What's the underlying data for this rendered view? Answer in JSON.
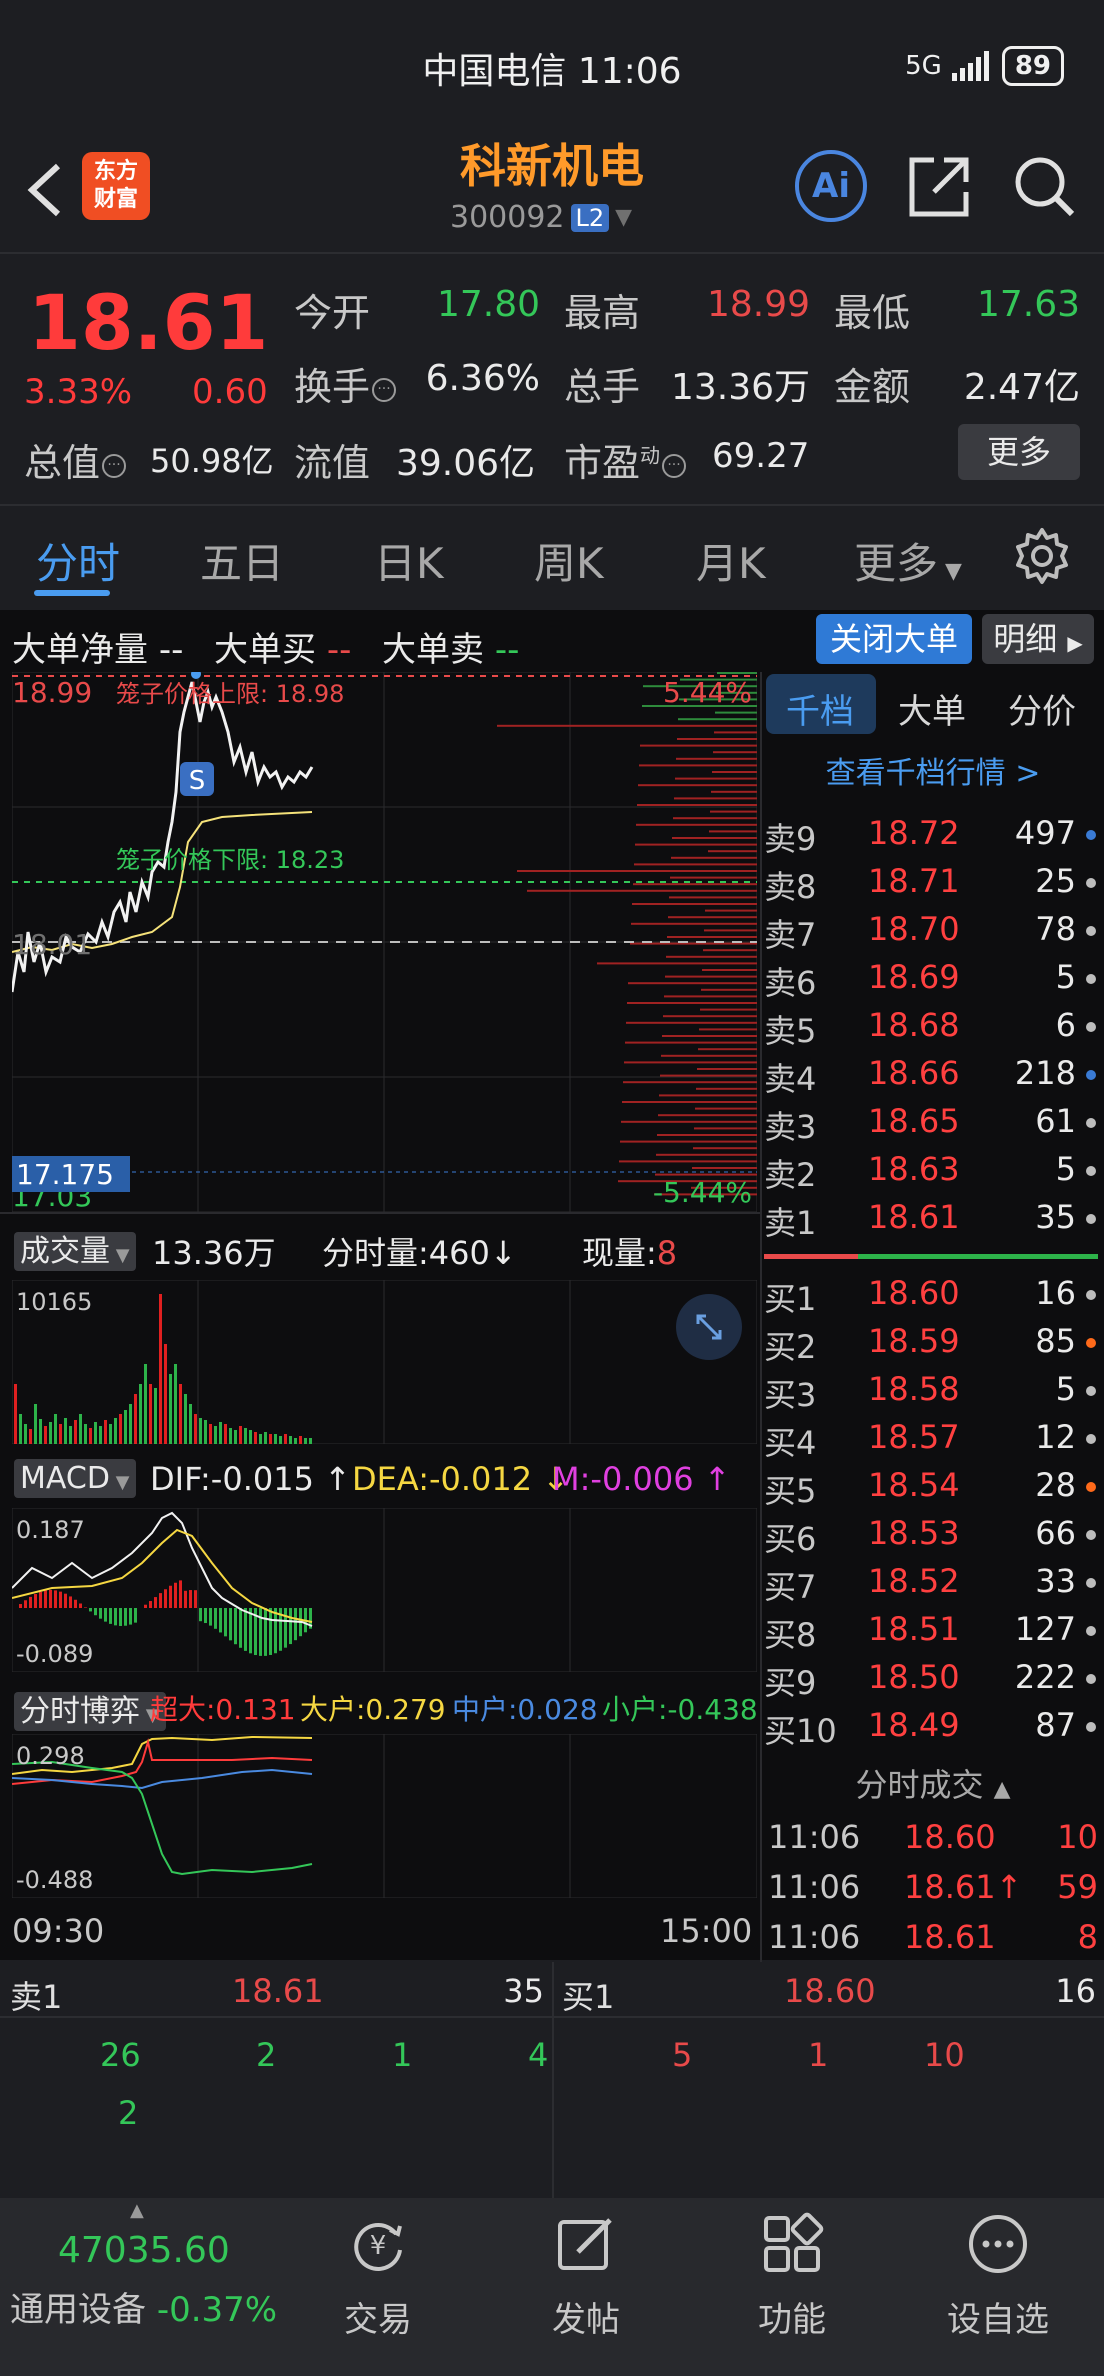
{
  "status_bar": {
    "carrier_time": "中国电信 11:06",
    "network": "5G",
    "battery": "89"
  },
  "header": {
    "stock_name": "科新机电",
    "stock_code": "300092",
    "level_badge": "L2",
    "logo_text_1": "东方",
    "logo_text_2": "财富",
    "ai_label": "Ai"
  },
  "quote": {
    "price": "18.61",
    "change_pct": "3.33%",
    "change_abs": "0.60",
    "fields": {
      "open_label": "今开",
      "open": "17.80",
      "high_label": "最高",
      "high": "18.99",
      "low_label": "最低",
      "low": "17.63",
      "turnover_label": "换手",
      "turnover": "6.36%",
      "volume_label": "总手",
      "volume": "13.36万",
      "amount_label": "金额",
      "amount": "2.47亿",
      "mktcap_label": "总值",
      "mktcap": "50.98亿",
      "float_label": "流值",
      "float": "39.06亿",
      "pe_label": "市盈",
      "pe_sup": "动",
      "pe": "69.27"
    },
    "more_label": "更多"
  },
  "tabs": [
    "分时",
    "五日",
    "日K",
    "周K",
    "月K",
    "更多"
  ],
  "big_order": {
    "net_label": "大单净量",
    "net_value": "--",
    "buy_label": "大单买",
    "buy_value": "--",
    "sell_label": "大单卖",
    "sell_value": "--",
    "close_btn": "关闭大单",
    "detail_btn": "明细"
  },
  "main_chart": {
    "top_price": "18.99",
    "upper_limit": "笼子价格上限: 18.98",
    "top_pct": "5.44%",
    "lower_limit": "笼子价格下限: 18.23",
    "mid_price": "18.01",
    "bottom_price": "17.175",
    "bottom_pct": "-5.44%",
    "bottom_price_under": "17.03",
    "marker": "S"
  },
  "order_book": {
    "tabs": [
      "千档",
      "大单",
      "分价"
    ],
    "link": "查看千档行情 >",
    "sells": [
      {
        "label": "卖9",
        "price": "18.72",
        "vol": "497",
        "dot": "#3a7bd5"
      },
      {
        "label": "卖8",
        "price": "18.71",
        "vol": "25",
        "dot": "#bdbdbd"
      },
      {
        "label": "卖7",
        "price": "18.70",
        "vol": "78",
        "dot": "#bdbdbd"
      },
      {
        "label": "卖6",
        "price": "18.69",
        "vol": "5",
        "dot": "#bdbdbd"
      },
      {
        "label": "卖5",
        "price": "18.68",
        "vol": "6",
        "dot": "#bdbdbd"
      },
      {
        "label": "卖4",
        "price": "18.66",
        "vol": "218",
        "dot": "#3a7bd5"
      },
      {
        "label": "卖3",
        "price": "18.65",
        "vol": "61",
        "dot": "#bdbdbd"
      },
      {
        "label": "卖2",
        "price": "18.63",
        "vol": "5",
        "dot": "#bdbdbd"
      },
      {
        "label": "卖1",
        "price": "18.61",
        "vol": "35",
        "dot": "#bdbdbd"
      }
    ],
    "buys": [
      {
        "label": "买1",
        "price": "18.60",
        "vol": "16",
        "dot": "#bdbdbd"
      },
      {
        "label": "买2",
        "price": "18.59",
        "vol": "85",
        "dot": "#ff6a1a"
      },
      {
        "label": "买3",
        "price": "18.58",
        "vol": "5",
        "dot": "#bdbdbd"
      },
      {
        "label": "买4",
        "price": "18.57",
        "vol": "12",
        "dot": "#bdbdbd"
      },
      {
        "label": "买5",
        "price": "18.54",
        "vol": "28",
        "dot": "#ff6a1a"
      },
      {
        "label": "买6",
        "price": "18.53",
        "vol": "66",
        "dot": "#bdbdbd"
      },
      {
        "label": "买7",
        "price": "18.52",
        "vol": "33",
        "dot": "#bdbdbd"
      },
      {
        "label": "买8",
        "price": "18.51",
        "vol": "127",
        "dot": "#bdbdbd"
      },
      {
        "label": "买9",
        "price": "18.50",
        "vol": "222",
        "dot": "#bdbdbd"
      },
      {
        "label": "买10",
        "price": "18.49",
        "vol": "87",
        "dot": "#bdbdbd"
      }
    ],
    "trades_header": "分时成交",
    "trades": [
      {
        "time": "11:06",
        "price": "18.60",
        "vol": "10",
        "arrow": ""
      },
      {
        "time": "11:06",
        "price": "18.61",
        "vol": "59",
        "arrow": "↑"
      },
      {
        "time": "11:06",
        "price": "18.61",
        "vol": "8",
        "arrow": ""
      }
    ]
  },
  "volume_panel": {
    "dropdown": "成交量",
    "total": "13.36万",
    "minute_label": "分时量:460",
    "minute_arrow": "↓",
    "now_label": "现量:",
    "now_value": "8",
    "max": "10165"
  },
  "macd_panel": {
    "dropdown": "MACD",
    "dif": "DIF:-0.015",
    "dif_arrow": "↑",
    "dea": "DEA:-0.012",
    "dea_arrow": "↓",
    "m": "M:-0.006",
    "m_arrow": "↑",
    "max": "0.187",
    "min": "-0.089"
  },
  "game_panel": {
    "dropdown": "分时博弈",
    "super": "超大:0.131",
    "large": "大户:0.279",
    "mid": "中户:0.028",
    "small": "小户:-0.438",
    "max": "0.298",
    "min": "-0.488"
  },
  "time_axis": {
    "start": "09:30",
    "end": "15:00"
  },
  "level_summary": {
    "sell_label": "卖1",
    "sell_price": "18.61",
    "sell_vol": "35",
    "buy_label": "买1",
    "buy_price": "18.60",
    "buy_vol": "16",
    "sell_queue_row1": [
      "26",
      "2",
      "1",
      "4"
    ],
    "sell_queue_row2": [
      "2"
    ],
    "buy_queue_row1": [
      "5",
      "1",
      "10"
    ]
  },
  "bottom_nav": {
    "index_value": "47035.60",
    "index_name": "通用设备",
    "index_pct": "-0.37%",
    "items": [
      "交易",
      "发帖",
      "功能",
      "设自选"
    ]
  },
  "colors": {
    "up": "#ff3b3b",
    "down": "#34c759",
    "accent": "#4a9cf0",
    "brand": "#ff9a2a"
  }
}
